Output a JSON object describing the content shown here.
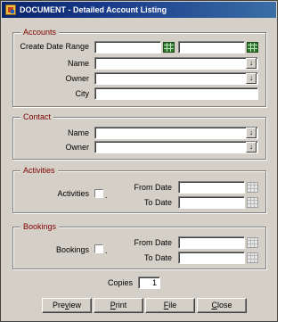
{
  "window": {
    "title": "DOCUMENT - Detailed Account Listing"
  },
  "accounts": {
    "title": "Accounts",
    "create_date_range_label": "Create Date Range",
    "create_date_from": "",
    "create_date_to": "",
    "name_label": "Name",
    "name_value": "",
    "owner_label": "Owner",
    "owner_value": "",
    "city_label": "City",
    "city_value": ""
  },
  "contact": {
    "title": "Contact",
    "name_label": "Name",
    "name_value": "",
    "owner_label": "Owner",
    "owner_value": ""
  },
  "activities": {
    "title": "Activities",
    "checkbox_label": "Activities",
    "checked": false,
    "from_date_label": "From Date",
    "from_date_value": "",
    "to_date_label": "To Date",
    "to_date_value": ""
  },
  "bookings": {
    "title": "Bookings",
    "checkbox_label": "Bookings",
    "checked": false,
    "from_date_label": "From Date",
    "from_date_value": "",
    "to_date_label": "To Date",
    "to_date_value": ""
  },
  "copies": {
    "label": "Copies",
    "value": "1"
  },
  "buttons": {
    "preview_pre": "Pre",
    "preview_key": "v",
    "preview_post": "iew",
    "print_key": "P",
    "print_post": "rint",
    "file_key": "F",
    "file_post": "ile",
    "close_key": "C",
    "close_post": "lose"
  },
  "icons": {
    "dropdown": "dropdown-arrow-icon",
    "calendar_active": "calendar-icon",
    "calendar_disabled": "calendar-icon"
  },
  "colors": {
    "group_title": "#800000",
    "window_bg": "#d4d0c8",
    "titlebar": "#08246b"
  }
}
